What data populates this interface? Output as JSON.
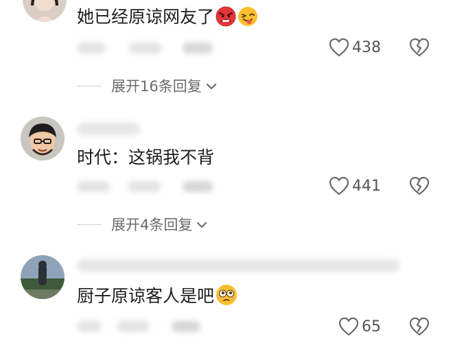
{
  "comments": [
    {
      "text": "她已经原谅网友了",
      "emojis": [
        "angry-face-emoji",
        "winking-tongue-emoji"
      ],
      "likes": "438",
      "expand_label": "展开16条回复"
    },
    {
      "text": "时代：这锅我不背",
      "emojis": [],
      "likes": "441",
      "expand_label": "展开4条回复"
    },
    {
      "text": "厨子原谅客人是吧",
      "emojis": [
        "flushed-face-emoji"
      ],
      "likes": "65"
    }
  ]
}
